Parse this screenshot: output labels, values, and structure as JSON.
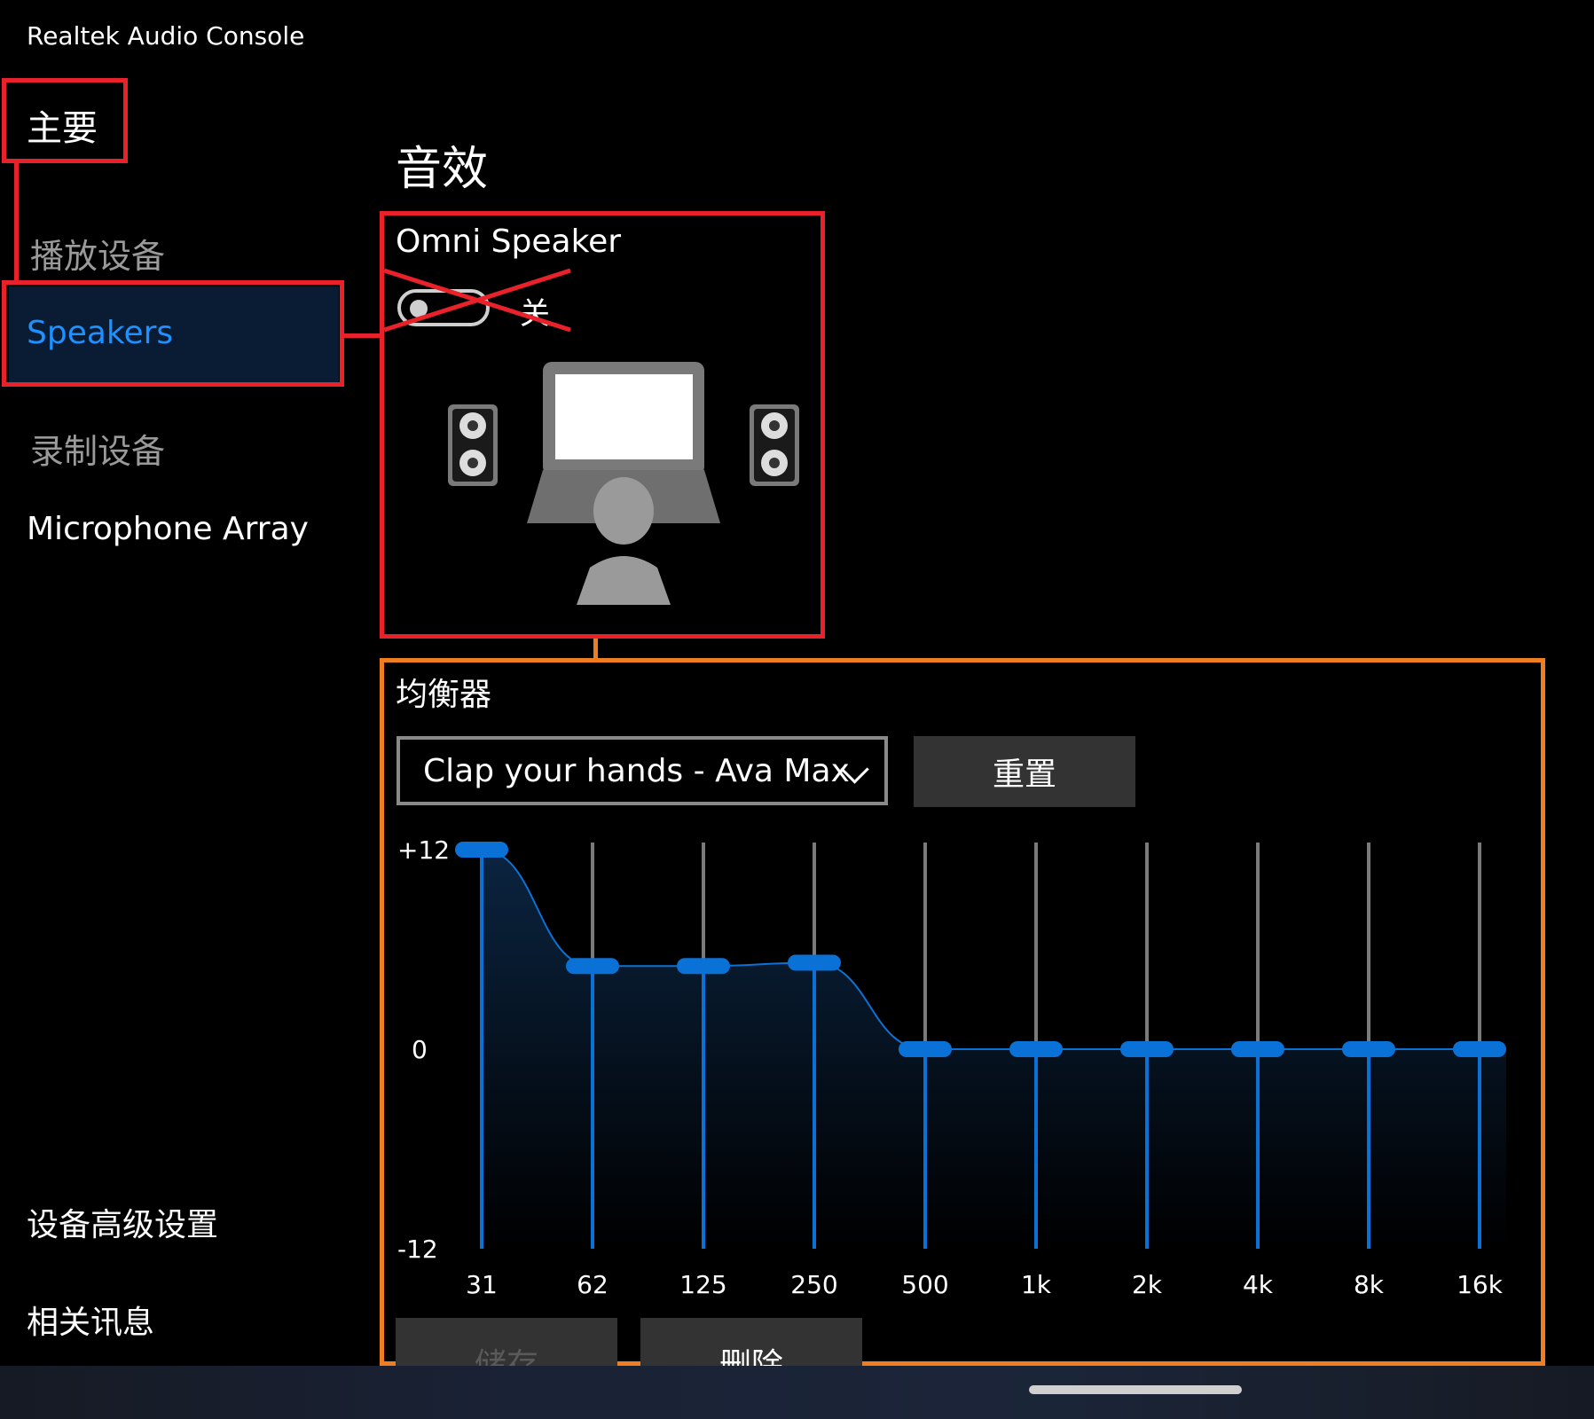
{
  "app": {
    "title": "Realtek Audio Console"
  },
  "sidebar": {
    "main_label": "主要",
    "playback_header": "播放设备",
    "playback_device": "Speakers",
    "recording_header": "录制设备",
    "recording_device": "Microphone Array",
    "advanced_settings": "设备高级设置",
    "related_info": "相关讯息"
  },
  "main": {
    "title": "音效",
    "omni": {
      "label": "Omni Speaker",
      "toggle_state": "关",
      "toggle_on": false
    },
    "equalizer": {
      "label": "均衡器",
      "preset": "Clap your hands - Ava Max",
      "reset_label": "重置",
      "save_label": "储存",
      "delete_label": "删除"
    }
  },
  "chart_data": {
    "type": "line",
    "title": "",
    "xlabel": "",
    "ylabel": "",
    "categories": [
      "31",
      "62",
      "125",
      "250",
      "500",
      "1k",
      "2k",
      "4k",
      "8k",
      "16k"
    ],
    "values": [
      12,
      5,
      5,
      5.2,
      0,
      0,
      0,
      0,
      0,
      0
    ],
    "ylim": [
      -12,
      12
    ],
    "y_tick_labels": [
      "+12",
      "0",
      "-12"
    ],
    "grid": false
  },
  "colors": {
    "accent": "#1e90ff",
    "slider_blue": "#0a72d6",
    "highlight_red": "#e8212a",
    "highlight_orange": "#f07d1f",
    "background": "#000000"
  }
}
